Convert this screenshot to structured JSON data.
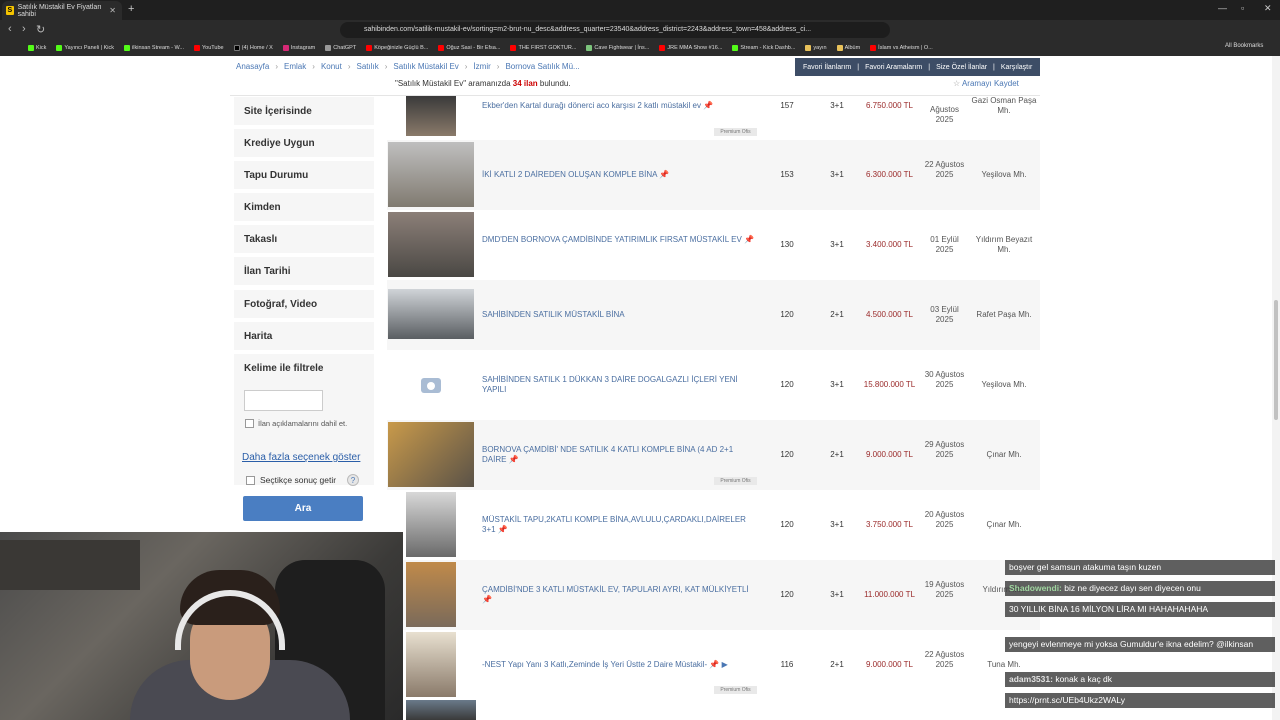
{
  "browser": {
    "tab_title": "Satılık Müstakil Ev Fiyatları sahibi",
    "tab_favicon": "S",
    "url": "sahibinden.com/satilik-mustakil-ev/sorting=m2-brut-nu_desc&address_quarter=23540&address_district=2243&address_town=458&address_ci...",
    "bookmarks": [
      "Kick",
      "Yayıncı Paneli | Kick",
      "ilkinsan Stream - W...",
      "YouTube",
      "(4) Home / X",
      "Instagram",
      "ChatGPT",
      "Köpeğinizle Güçlü B...",
      "Oğuz Sasi - Bir Efsa...",
      "THE FIRST GOKTUR...",
      "Cave Fightwear | İns...",
      "JRE MMA Show #16...",
      "Stream - Kick Dashb...",
      "yayın",
      "Albüm",
      "İslam vs Atheism | O..."
    ],
    "all_bookmarks": "All Bookmarks"
  },
  "breadcrumb": [
    "Anasayfa",
    "Emlak",
    "Konut",
    "Satılık",
    "Satılık Müstakil Ev",
    "İzmir",
    "Bornova Satılık Mü..."
  ],
  "favbar": [
    "Favori İlanlarım",
    "Favori Aramalarım",
    "Size Özel İlanlar",
    "Karşılaştır"
  ],
  "summary": {
    "query": "\"Satılık Müstakil Ev\"",
    "middle": "aramanızda",
    "count": "34 ilan",
    "tail": "bulundu."
  },
  "save_search": "Aramayı Kaydet",
  "filters": [
    "Site İçerisinde",
    "Krediye Uygun",
    "Tapu Durumu",
    "Kimden",
    "Takaslı",
    "İlan Tarihi",
    "Fotoğraf, Video",
    "Harita",
    "Kelime ile filtrele"
  ],
  "keyword_checkbox_label": "İlan açıklamalarını dahil et.",
  "more_options": "Daha fazla seçenek göster",
  "instant_results_label": "Seçtikçe sonuç getir",
  "help": "?",
  "search_button": "Ara",
  "premium_label": "Premium Ofis",
  "listings": [
    {
      "title": "Ekber'den Kartal durağı dönerci aco karşısı 2 katlı müstakil ev",
      "m2": "157",
      "rooms": "3+1",
      "price": "6.750.000 TL",
      "date": "Ağustos 2025",
      "location": "Gazi Osman Paşa Mh.",
      "premium": true
    },
    {
      "title": "İKİ KATLI 2 DAİREDEN OLUŞAN KOMPLE BİNA",
      "m2": "153",
      "rooms": "3+1",
      "price": "6.300.000 TL",
      "date": "22 Ağustos 2025",
      "location": "Yeşilova Mh.",
      "premium": false
    },
    {
      "title": "DMD'DEN BORNOVA ÇAMDİBİNDE YATIRIMLIK FIRSAT MÜSTAKİL EV",
      "m2": "130",
      "rooms": "3+1",
      "price": "3.400.000 TL",
      "date": "01 Eylül 2025",
      "location": "Yıldırım Beyazıt Mh.",
      "premium": false
    },
    {
      "title": "SAHİBİNDEN SATILIK MÜSTAKİL BİNA",
      "m2": "120",
      "rooms": "2+1",
      "price": "4.500.000 TL",
      "date": "03 Eylül 2025",
      "location": "Rafet Paşa Mh.",
      "premium": false
    },
    {
      "title": "SAHİBİNDEN SATILK 1 DÜKKAN 3 DAİRE DOGALGAZLI İÇLERİ YENİ YAPILI",
      "m2": "120",
      "rooms": "3+1",
      "price": "15.800.000 TL",
      "date": "30 Ağustos 2025",
      "location": "Yeşilova Mh.",
      "premium": false
    },
    {
      "title": "BORNOVA ÇAMDİBİ' NDE SATILIK 4 KATLI KOMPLE BİNA (4 AD 2+1 DAİRE",
      "m2": "120",
      "rooms": "2+1",
      "price": "9.000.000 TL",
      "date": "29 Ağustos 2025",
      "location": "Çınar Mh.",
      "premium": true
    },
    {
      "title": "MÜSTAKİL TAPU,2KATLI KOMPLE BİNA,AVLULU,ÇARDAKLI,DAİRELER 3+1",
      "m2": "120",
      "rooms": "3+1",
      "price": "3.750.000 TL",
      "date": "20 Ağustos 2025",
      "location": "Çınar Mh.",
      "premium": false
    },
    {
      "title": "ÇAMDİBİ'NDE 3 KATLI MÜSTAKİL EV, TAPULARI AYRI, KAT MÜLKİYETLİ",
      "m2": "120",
      "rooms": "3+1",
      "price": "11.000.000 TL",
      "date": "19 Ağustos 2025",
      "location": "Yıldırım Mh.",
      "premium": false
    },
    {
      "title": "-NEST Yapı Yanı 3 Katlı,Zeminde İş Yeri Üstte 2 Daire Müstakil-",
      "m2": "116",
      "rooms": "2+1",
      "price": "9.000.000 TL",
      "date": "22 Ağustos 2025",
      "location": "Tuna Mh.",
      "premium": true
    }
  ],
  "chat": [
    {
      "user": "",
      "text": "boşver gel samsun atakuma taşın kuzen"
    },
    {
      "user": "Shadowendi:",
      "text": "biz ne diyecez dayı sen diyecen onu"
    },
    {
      "user": "",
      "text": "30 YILLIK BİNA 16 MİLYON LİRA MI HAHAHAHAHA"
    },
    {
      "user": "",
      "text": "yengeyi evlenmeye mi yoksa Gumuldur'e ikna edelim? @ilkinsan"
    },
    {
      "user": "adam3531:",
      "text": "konak a kaç dk"
    },
    {
      "user": "",
      "text": "https://prnt.sc/UEb4Ukz2WALy"
    }
  ],
  "colors": {
    "link": "#4a6ea0",
    "price": "#9a2a2a",
    "accent_button": "#4a7ec2",
    "favbar": "#3d4d66"
  }
}
